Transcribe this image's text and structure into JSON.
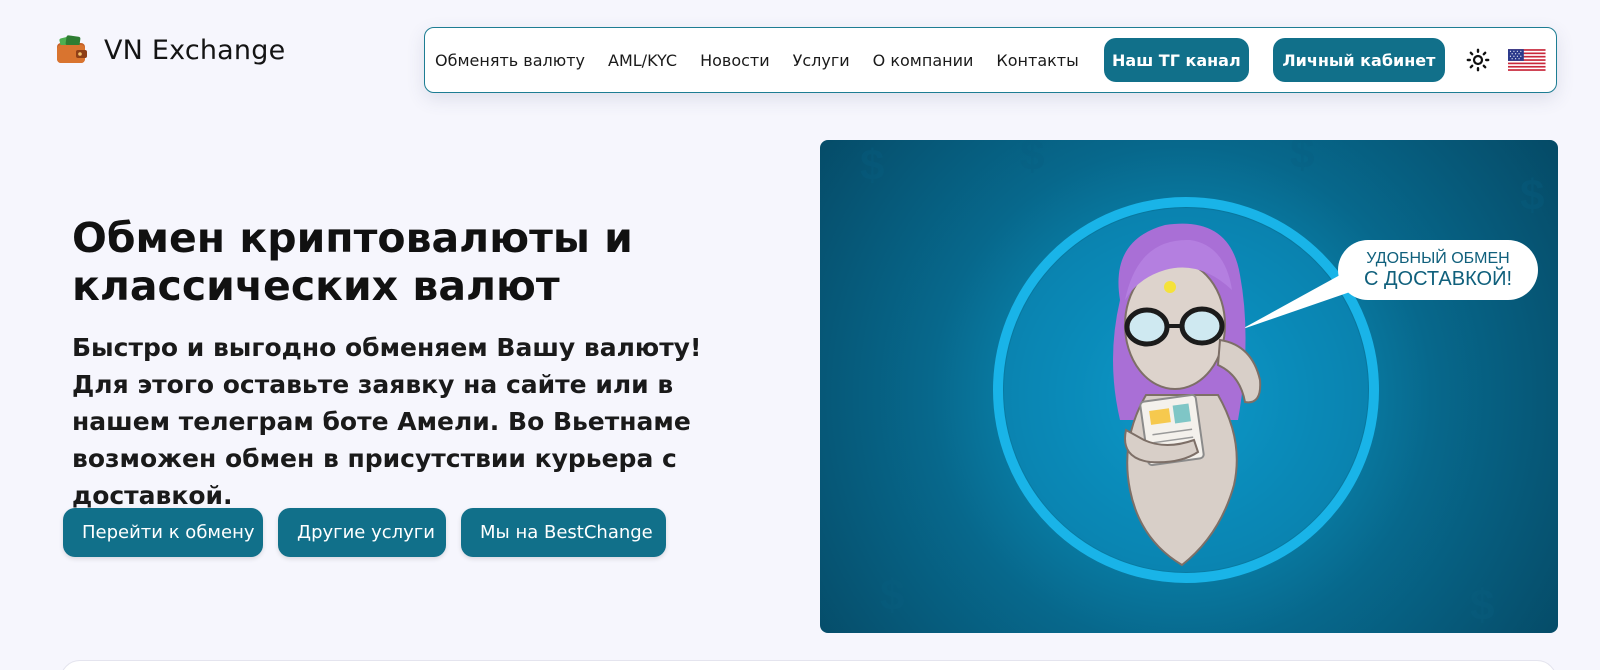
{
  "brand": {
    "name": "VN Exchange",
    "logo_icon": "wallet-icon"
  },
  "nav": {
    "links": [
      "Обменять валюту",
      "AML/KYC",
      "Новости",
      "Услуги",
      "О компании",
      "Контакты"
    ],
    "tg_button": "Наш ТГ канал",
    "cabinet_button": "Личный кабинет",
    "theme_icon": "sun-icon",
    "language_icon": "us-flag-icon"
  },
  "hero": {
    "title": "Обмен криптовалюты и классических валют",
    "subtitle": "Быстро и выгодно обменяем Вашу валюту! Для этого оставьте заявку на сайте или в нашем телеграм боте Амели. Во Вьетнаме возможен обмен в присутствии курьера с доставкой.",
    "buttons": [
      "Перейти к обмену",
      "Другие услуги",
      "Мы на BestChange"
    ]
  },
  "banner": {
    "speech_line1": "УДОБНЫЙ ОБМЕН",
    "speech_line2": "С ДОСТАВКОЙ!"
  },
  "colors": {
    "accent": "#11708a",
    "page_background": "#f6f6fd",
    "banner_blue": "#0a86b0"
  }
}
